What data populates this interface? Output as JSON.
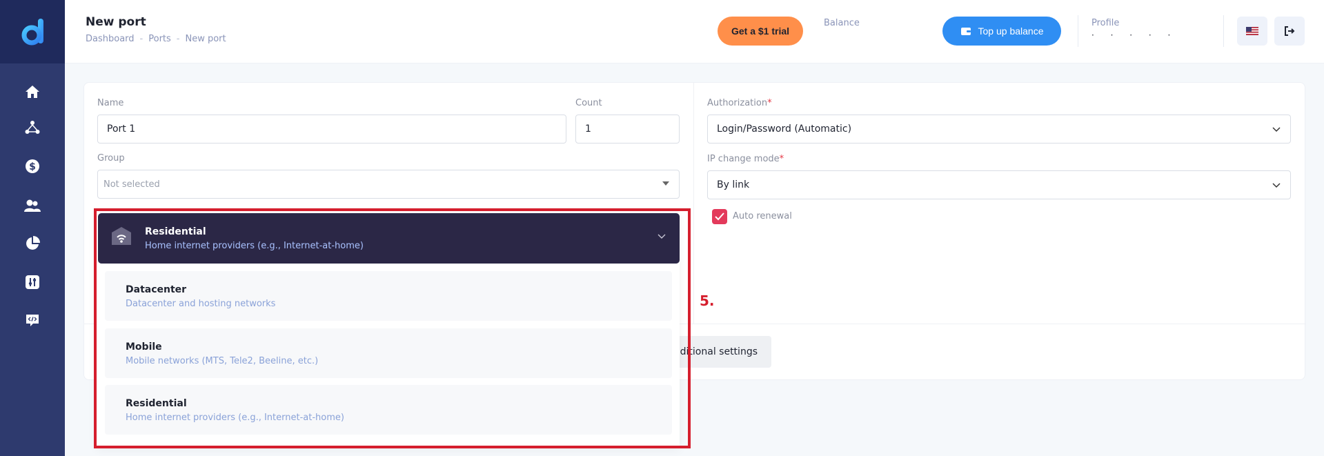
{
  "header": {
    "title": "New port",
    "breadcrumb": [
      "Dashboard",
      "Ports",
      "New port"
    ],
    "trial_button": "Get a $1 trial",
    "balance_label": "Balance",
    "topup_button": "Top up balance",
    "profile_label": "Profile",
    "profile_value": "· · · · ·"
  },
  "sidebar": {
    "items": [
      "home-icon",
      "network-icon",
      "dollar-icon",
      "users-icon",
      "pie-chart-icon",
      "settings-sliders-icon",
      "code-icon"
    ]
  },
  "form": {
    "name_label": "Name",
    "name_value": "Port 1",
    "count_label": "Count",
    "count_value": "1",
    "group_label": "Group",
    "group_placeholder": "Not selected",
    "authorization_label": "Authorization",
    "authorization_value": "Login/Password (Automatic)",
    "ip_mode_label": "IP change mode",
    "ip_mode_value": "By link",
    "auto_renewal_label": "Auto renewal",
    "additional_settings": "dditional settings"
  },
  "dropdown": {
    "selected": {
      "title": "Residential",
      "subtitle": "Home internet providers (e.g., Internet-at-home)"
    },
    "options": [
      {
        "title": "Datacenter",
        "subtitle": "Datacenter and hosting networks"
      },
      {
        "title": "Mobile",
        "subtitle": "Mobile networks (MTS, Tele2, Beeline, etc.)"
      },
      {
        "title": "Residential",
        "subtitle": "Home internet providers (e.g., Internet-at-home)"
      }
    ]
  },
  "annotation": {
    "step": "5."
  },
  "colors": {
    "sidebar": "#2e3a6e",
    "accent_orange": "#ff8f4a",
    "accent_blue": "#2f8ef3",
    "dropdown_selected": "#2b2746",
    "highlight": "#d51e2d"
  }
}
